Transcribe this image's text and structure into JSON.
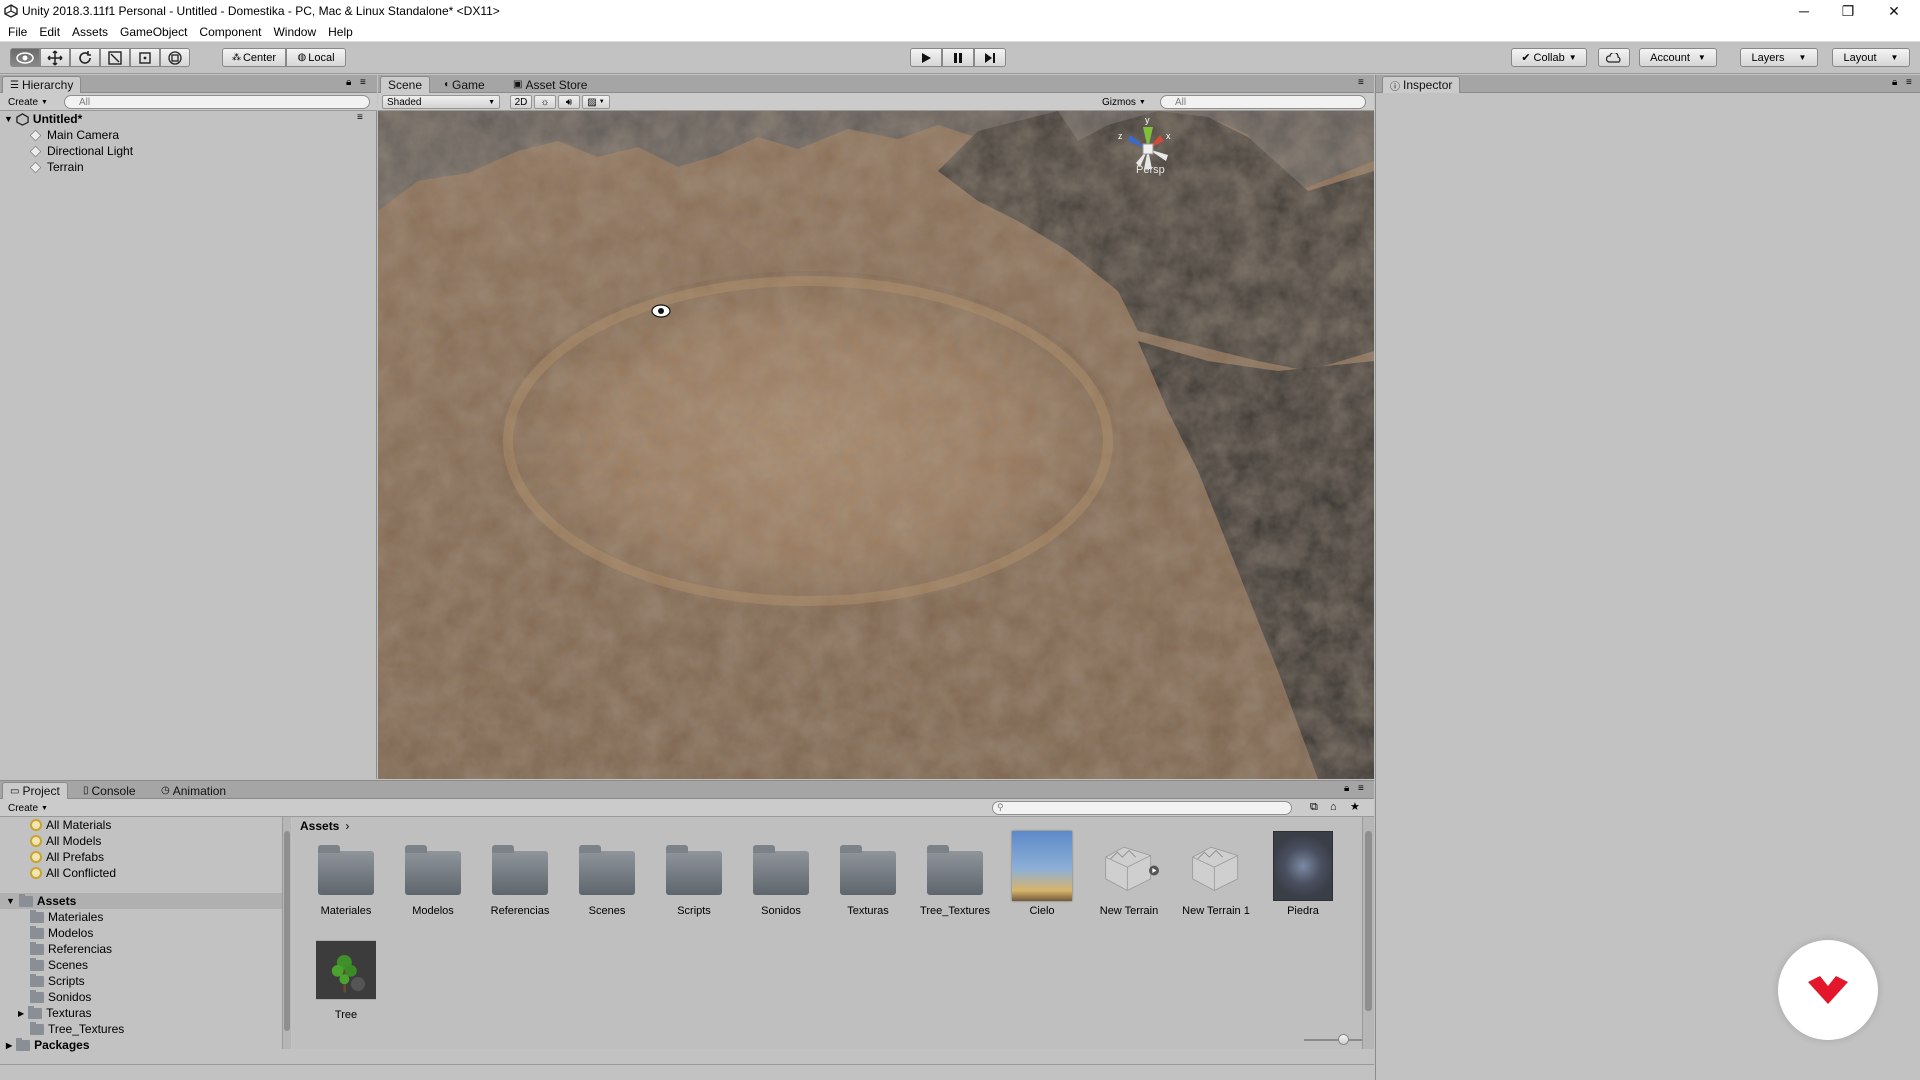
{
  "window": {
    "title": "Unity 2018.3.11f1 Personal - Untitled - Domestika - PC, Mac & Linux Standalone* <DX11>",
    "minimize": "─",
    "restore": "❐",
    "close": "✕"
  },
  "menu": [
    "File",
    "Edit",
    "Assets",
    "GameObject",
    "Component",
    "Window",
    "Help"
  ],
  "toolbar": {
    "center_label": "Center",
    "local_label": "Local",
    "collab_label": "Collab",
    "account_label": "Account",
    "layers_label": "Layers",
    "layout_label": "Layout"
  },
  "hierarchy": {
    "tab_label": "Hierarchy",
    "create_label": "Create",
    "search_placeholder": "All",
    "scene_name": "Untitled*",
    "items": [
      "Main Camera",
      "Directional Light",
      "Terrain"
    ]
  },
  "scene_view": {
    "tabs": [
      "Scene",
      "Game",
      "Asset Store"
    ],
    "shading": "Shaded",
    "mode_2d": "2D",
    "gizmos_label": "Gizmos",
    "search_placeholder": "All",
    "persp_label": "Persp",
    "axis_y": "y",
    "axis_z": "z",
    "axis_x": "x"
  },
  "inspector": {
    "tab_label": "Inspector"
  },
  "bottom": {
    "tabs": [
      "Project",
      "Console",
      "Animation"
    ],
    "create_label": "Create",
    "favorites": [
      "All Materials",
      "All Models",
      "All Prefabs",
      "All Conflicted"
    ],
    "assets_root": "Assets",
    "folders": [
      "Materiales",
      "Modelos",
      "Referencias",
      "Scenes",
      "Scripts",
      "Sonidos",
      "Texturas",
      "Tree_Textures"
    ],
    "packages_label": "Packages",
    "breadcrumb": "Assets",
    "grid_items": [
      "Materiales",
      "Modelos",
      "Referencias",
      "Scenes",
      "Scripts",
      "Sonidos",
      "Texturas",
      "Tree_Textures",
      "Cielo",
      "New Terrain",
      "New Terrain 1",
      "Piedra",
      "Tree"
    ]
  },
  "colors": {
    "accent_red": "#e3162c",
    "panel_bg": "#c2c2c2",
    "tab_bg": "#a5a5a5"
  }
}
